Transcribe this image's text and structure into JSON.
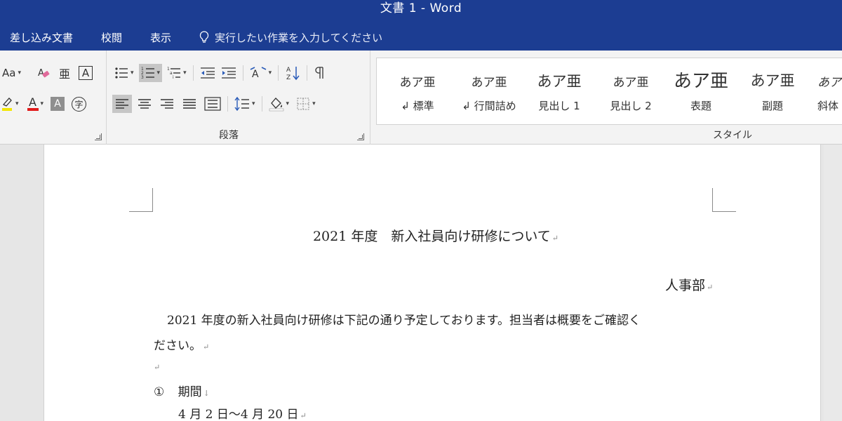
{
  "window": {
    "title": "文書 1 - Word"
  },
  "menu": {
    "items": [
      "差し込み文書",
      "校閲",
      "表示"
    ],
    "tell_me": "実行したい作業を入力してください"
  },
  "ribbon": {
    "font": {
      "case_label": "Aa",
      "ruby_glyph": "亜",
      "boxed_glyph": "A",
      "color_glyph": "A",
      "shade_glyph": "A",
      "enclose_glyph": "字"
    },
    "paragraph": {
      "label": "段落"
    },
    "styles": {
      "label": "スタイル",
      "items": [
        {
          "sample": "あア亜",
          "name": "↲ 標準"
        },
        {
          "sample": "あア亜",
          "name": "↲ 行間詰め"
        },
        {
          "sample": "あア亜",
          "name": "見出し 1"
        },
        {
          "sample": "あア亜",
          "name": "見出し 2"
        },
        {
          "sample": "あア亜",
          "name": "表題"
        },
        {
          "sample": "あア亜",
          "name": "副題"
        },
        {
          "sample": "あア",
          "name": "斜体"
        }
      ]
    },
    "colors": {
      "highlight": "#f2e600",
      "font_color": "#e21a1a"
    }
  },
  "document": {
    "title": "2021 年度　新入社員向け研修について",
    "department": "人事部",
    "body_line1": "2021 年度の新入社員向け研修は下記の通り予定しております。担当者は概要をご確認く",
    "body_line2": "ださい。",
    "item1_label": "①",
    "item1_heading": "期間",
    "item1_detail": "4 月 2 日〜4 月 20 日",
    "para_mark": "↵",
    "line_break_mark": "↓"
  }
}
